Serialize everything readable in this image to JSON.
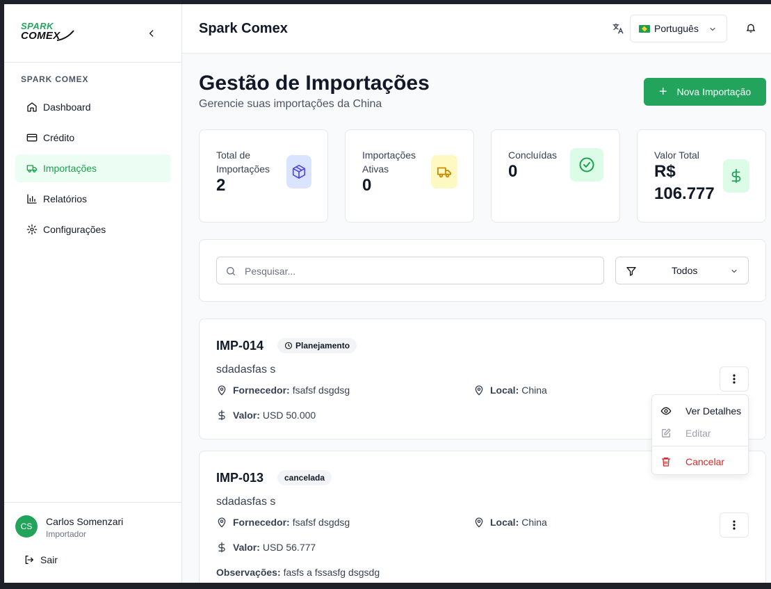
{
  "brand": {
    "line1": "SPARK",
    "line2": "COMEX",
    "accent_color": "#22a45d"
  },
  "sidebar": {
    "section_label": "SPARK COMEX",
    "items": [
      {
        "label": "Dashboard",
        "icon": "home-icon",
        "active": false
      },
      {
        "label": "Crédito",
        "icon": "credit-card-icon",
        "active": false
      },
      {
        "label": "Importações",
        "icon": "truck-icon",
        "active": true
      },
      {
        "label": "Relatórios",
        "icon": "bar-chart-icon",
        "active": false
      },
      {
        "label": "Configurações",
        "icon": "gear-icon",
        "active": false
      }
    ],
    "user": {
      "initials": "CS",
      "name": "Carlos Somenzari",
      "role": "Importador"
    },
    "logout_label": "Sair"
  },
  "header": {
    "title": "Spark Comex",
    "language": "Português"
  },
  "page": {
    "title": "Gestão de Importações",
    "subtitle": "Gerencie suas importações da China",
    "new_button": "Nova Importação"
  },
  "stats": [
    {
      "label": "Total de Importações",
      "value": "2",
      "icon": "box-icon",
      "color": "#4f46e5"
    },
    {
      "label": "Importações Ativas",
      "value": "0",
      "icon": "truck-icon",
      "color": "#ca8a04"
    },
    {
      "label": "Concluídas",
      "value": "0",
      "icon": "check-circle-icon",
      "color": "#16a34a"
    },
    {
      "label": "Valor Total",
      "value": "R$ 106.777",
      "icon": "dollar-icon",
      "color": "#22a45d"
    }
  ],
  "filters": {
    "search_placeholder": "Pesquisar...",
    "status_value": "Todos"
  },
  "imports": [
    {
      "id": "IMP-014",
      "status": "Planejamento",
      "description": "sdadasfas s",
      "supplier_label": "Fornecedor:",
      "supplier": "fsafsf dsgdsg",
      "location_label": "Local:",
      "location": "China",
      "value_label": "Valor:",
      "value": "USD 50.000"
    },
    {
      "id": "IMP-013",
      "status": "cancelada",
      "description": "sdadasfas s",
      "supplier_label": "Fornecedor:",
      "supplier": "fsafsf dsgdsg",
      "location_label": "Local:",
      "location": "China",
      "value_label": "Valor:",
      "value": "USD 56.777",
      "notes_label": "Observações:",
      "notes": "fasfs a fssasfg dsgsdg"
    }
  ],
  "context_menu": {
    "view": "Ver Detalhes",
    "edit": "Editar",
    "cancel": "Cancelar",
    "cancel_color": "#dc2626"
  }
}
